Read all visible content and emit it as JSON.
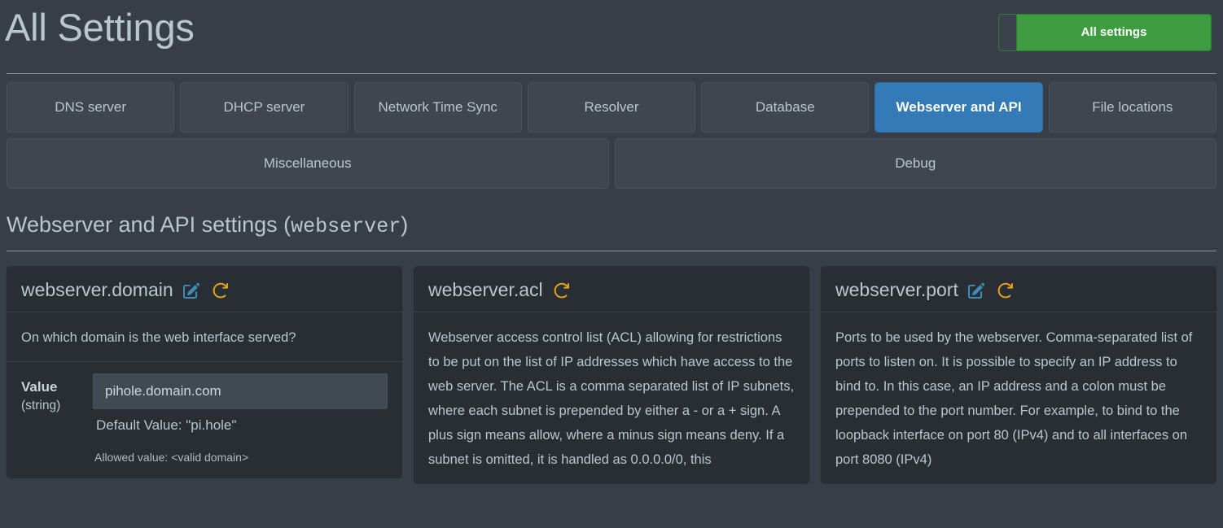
{
  "header": {
    "title": "All Settings",
    "all_settings_button": "All settings",
    "accent_green": "#3d9c40"
  },
  "tabs": {
    "row1": [
      {
        "label": "DNS server",
        "active": false
      },
      {
        "label": "DHCP server",
        "active": false
      },
      {
        "label": "Network Time Sync",
        "active": false
      },
      {
        "label": "Resolver",
        "active": false
      },
      {
        "label": "Database",
        "active": false
      },
      {
        "label": "Webserver and API",
        "active": true
      },
      {
        "label": "File locations",
        "active": false
      }
    ],
    "row2": [
      {
        "label": "Miscellaneous",
        "active": false
      },
      {
        "label": "Debug",
        "active": false
      }
    ],
    "active_color": "#337ab7"
  },
  "section": {
    "title_text": "Webserver and API settings (",
    "title_code": "webserver",
    "title_close": ")"
  },
  "cards": [
    {
      "title": "webserver.domain",
      "has_edit_icon": true,
      "has_reset_icon": true,
      "description": "On which domain is the web interface served?",
      "value_label": "Value",
      "value_type": "(string)",
      "value": "pihole.domain.com",
      "default_value": "Default Value: \"pi.hole\"",
      "allowed_value": "Allowed value: <valid domain>"
    },
    {
      "title": "webserver.acl",
      "has_edit_icon": false,
      "has_reset_icon": true,
      "description": "Webserver access control list (ACL) allowing for restrictions to be put on the list of IP addresses which have access to the web server. The ACL is a comma separated list of IP subnets, where each subnet is prepended by either a - or a + sign. A plus sign means allow, where a minus sign means deny. If a subnet is omitted, it is handled as 0.0.0.0/0, this"
    },
    {
      "title": "webserver.port",
      "has_edit_icon": true,
      "has_reset_icon": true,
      "description": "Ports to be used by the webserver. Comma-separated list of ports to listen on. It is possible to specify an IP address to bind to. In this case, an IP address and a colon must be prepended to the port number. For example, to bind to the loopback interface on port 80 (IPv4) and to all interfaces on port 8080 (IPv4)"
    }
  ],
  "icons": {
    "edit": "pen-to-square-icon",
    "reset": "rotate-right-icon"
  }
}
